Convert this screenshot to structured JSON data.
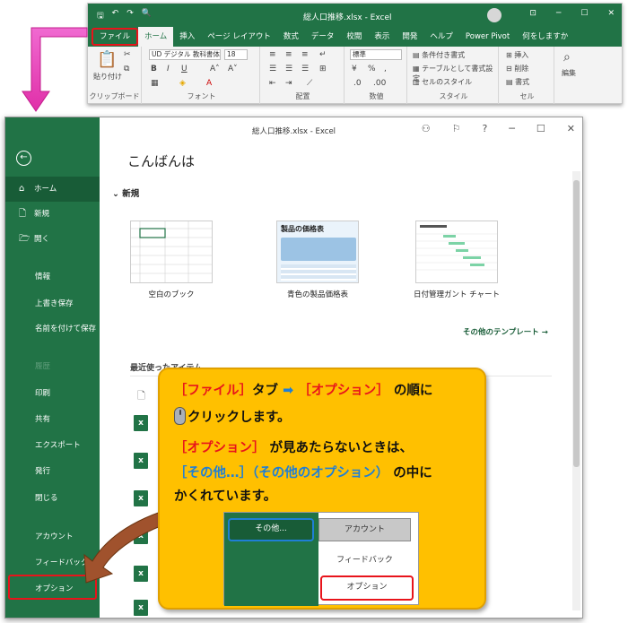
{
  "ribbon": {
    "title": "総人口推移.xlsx - Excel",
    "tabs": [
      "ファイル",
      "ホーム",
      "挿入",
      "ページ レイアウト",
      "数式",
      "データ",
      "校閲",
      "表示",
      "開発",
      "ヘルプ",
      "Power Pivot",
      "何をしますか"
    ],
    "font_name": "UD デジタル 教科書体",
    "font_size": "18",
    "number_format": "標準",
    "paste_label": "貼り付け",
    "styles": [
      "条件付き書式",
      "テーブルとして書式設定",
      "セルのスタイル"
    ],
    "cells": [
      "挿入",
      "削除",
      "書式"
    ],
    "edit_label": "編集",
    "groups": [
      "クリップボード",
      "フォント",
      "配置",
      "数値",
      "スタイル",
      "セル"
    ]
  },
  "backstage": {
    "title": "総人口推移.xlsx - Excel",
    "greeting": "こんばんは",
    "new_header": "新規",
    "sidebar": {
      "home": "ホーム",
      "new": "新規",
      "open": "開く",
      "info": "情報",
      "save": "上書き保存",
      "save_as": "名前を付けて保存",
      "print_disabled": "履歴",
      "print": "印刷",
      "share": "共有",
      "export": "エクスポート",
      "publish": "発行",
      "close": "閉じる",
      "account": "アカウント",
      "feedback": "フィードバック",
      "options": "オプション"
    },
    "templates": [
      {
        "label": "空白のブック"
      },
      {
        "label": "青色の製品価格表",
        "thumb_title": "製品の価格表"
      },
      {
        "label": "日付管理ガント チャート"
      }
    ],
    "more_templates": "その他のテンプレート →",
    "recent_header": "最近使ったアイテム"
  },
  "callout": {
    "line1_a": "［ファイル］",
    "line1_b": "タブ ",
    "line1_c": "➡",
    "line1_d": " ［オプション］",
    "line1_e": " の順に",
    "line2": "クリックします。",
    "line3_a": "［オプション］",
    "line3_b": " が見あたらないときは、",
    "line4_a": "［その他…］（その他のオプション）",
    "line4_b": " の中に",
    "line5": "かくれています。",
    "mini_other": "その他...",
    "mini_account": "アカウント",
    "mini_feedback": "フィードバック",
    "mini_options": "オプション"
  },
  "colors": {
    "excel_green": "#217346",
    "highlight_red": "#e8141b",
    "callout_yellow": "#ffc000",
    "link_blue": "#1f7fd6"
  }
}
